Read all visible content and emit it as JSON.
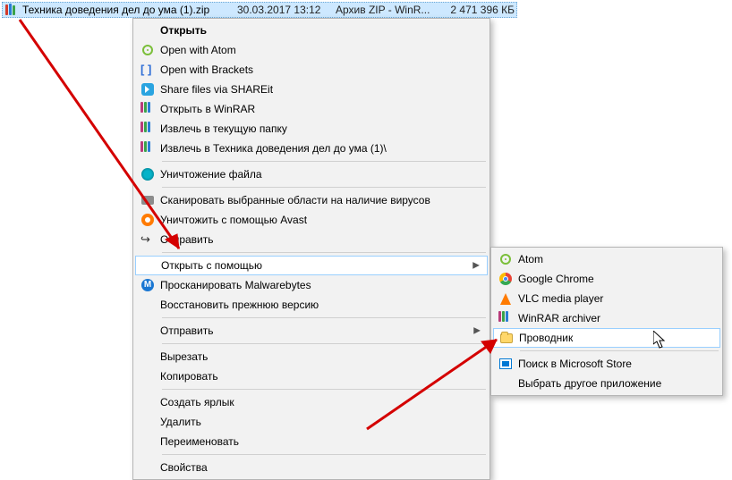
{
  "file": {
    "name": "Техника доведения дел до ума (1).zip",
    "date": "30.03.2017 13:12",
    "type": "Архив ZIP - WinR...",
    "size": "2 471 396 КБ"
  },
  "menu": {
    "open": "Открыть",
    "open_atom": "Open with Atom",
    "open_brackets": "Open with Brackets",
    "shareit": "Share files via SHAREit",
    "open_winrar": "Открыть в WinRAR",
    "extract_here": "Извлечь в текущую папку",
    "extract_to": "Извлечь в Техника доведения дел до ума (1)\\",
    "iobit": "Уничтожение файла",
    "scan": "Сканировать выбранные области на наличие вирусов",
    "avast": "Уничтожить с помощью Avast",
    "send_share": "Отправить",
    "open_with": "Открыть с помощью",
    "mwb": "Просканировать Malwarebytes",
    "restore": "Восстановить прежнюю версию",
    "send_to": "Отправить",
    "cut": "Вырезать",
    "copy": "Копировать",
    "shortcut": "Создать ярлык",
    "delete": "Удалить",
    "rename": "Переименовать",
    "properties": "Свойства"
  },
  "submenu": {
    "atom": "Atom",
    "chrome": "Google Chrome",
    "vlc": "VLC media player",
    "winrar": "WinRAR archiver",
    "explorer": "Проводник",
    "store": "Поиск в Microsoft Store",
    "choose": "Выбрать другое приложение"
  }
}
